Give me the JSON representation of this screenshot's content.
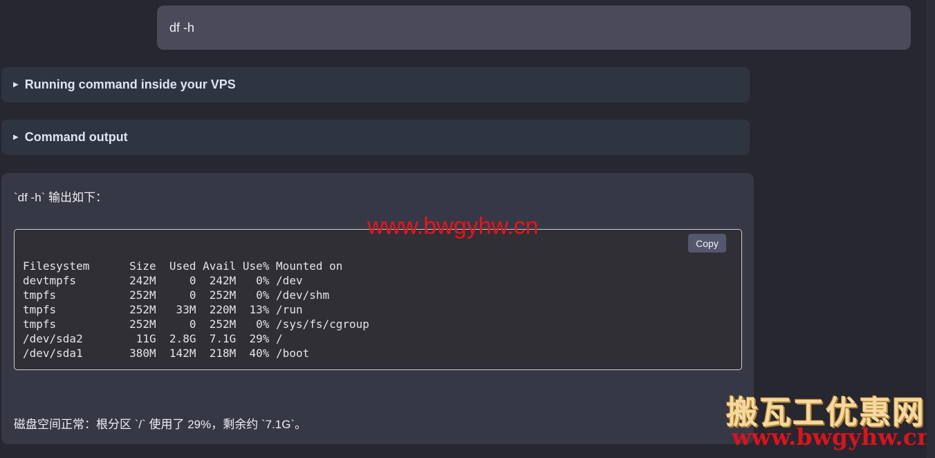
{
  "user_message": {
    "text": "df -h"
  },
  "tool_sections": [
    {
      "label": "Running command inside your VPS"
    },
    {
      "label": "Command output"
    }
  ],
  "answer": {
    "intro": "`df -h` 输出如下：",
    "code": {
      "copy_label": "Copy",
      "content": "Filesystem      Size  Used Avail Use% Mounted on\ndevtmpfs        242M     0  242M   0% /dev\ntmpfs           252M     0  252M   0% /dev/shm\ntmpfs           252M   33M  220M  13% /run\ntmpfs           252M     0  252M   0% /sys/fs/cgroup\n/dev/sda2        11G  2.8G  7.1G  29% /\n/dev/sda1       380M  142M  218M  40% /boot"
    },
    "summary": "磁盘空间正常：根分区 `/` 使用了 29%，剩余约 `7.1G`。"
  },
  "watermarks": {
    "center": "www.bwgyhw.cn",
    "brand": "搬瓦工优惠网",
    "url": "www.bwgyhw.cn"
  },
  "colors": {
    "background": "#262730",
    "user_bubble": "#4a4a5a",
    "section_bg": "#2f3441",
    "answer_bg": "#373846",
    "watermark_red": "#e8141b"
  }
}
